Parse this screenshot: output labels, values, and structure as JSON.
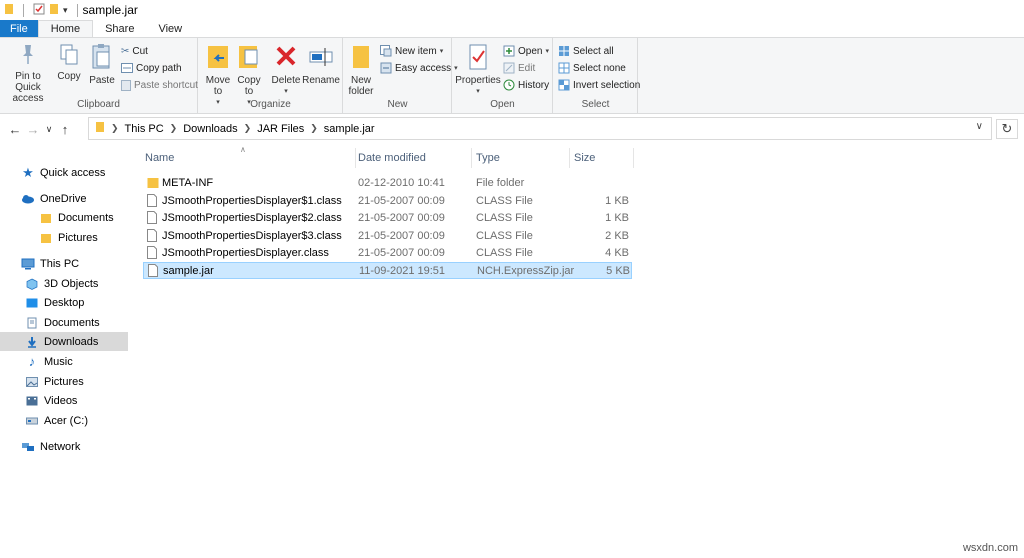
{
  "window": {
    "title": "sample.jar"
  },
  "tabs": [
    {
      "label": "File"
    },
    {
      "label": "Home"
    },
    {
      "label": "Share"
    },
    {
      "label": "View"
    }
  ],
  "ribbon": {
    "clipboard": {
      "label": "Clipboard",
      "pin": "Pin to Quick access",
      "copy": "Copy",
      "paste": "Paste",
      "cut": "Cut",
      "copy_path": "Copy path",
      "paste_shortcut": "Paste shortcut"
    },
    "organize": {
      "label": "Organize",
      "move_to": "Move to",
      "copy_to": "Copy to",
      "delete": "Delete",
      "rename": "Rename"
    },
    "new": {
      "label": "New",
      "new_folder": "New folder",
      "new_item": "New item",
      "easy_access": "Easy access"
    },
    "open": {
      "label": "Open",
      "properties": "Properties",
      "open": "Open",
      "edit": "Edit",
      "history": "History"
    },
    "select": {
      "label": "Select",
      "select_all": "Select all",
      "select_none": "Select none",
      "invert": "Invert selection"
    }
  },
  "address": {
    "crumbs": [
      "This PC",
      "Downloads",
      "JAR Files",
      "sample.jar"
    ]
  },
  "nav": {
    "quick_access": "Quick access",
    "onedrive": "OneDrive",
    "documents1": "Documents",
    "pictures1": "Pictures",
    "this_pc": "This PC",
    "objects3d": "3D Objects",
    "desktop": "Desktop",
    "documents2": "Documents",
    "downloads": "Downloads",
    "music": "Music",
    "pictures2": "Pictures",
    "videos": "Videos",
    "acer": "Acer (C:)",
    "network": "Network"
  },
  "columns": {
    "name": "Name",
    "date": "Date modified",
    "type": "Type",
    "size": "Size"
  },
  "files": [
    {
      "name": "META-INF",
      "date": "02-12-2010 10:41",
      "type": "File folder",
      "size": ""
    },
    {
      "name": "JSmoothPropertiesDisplayer$1.class",
      "date": "21-05-2007 00:09",
      "type": "CLASS File",
      "size": "1 KB"
    },
    {
      "name": "JSmoothPropertiesDisplayer$2.class",
      "date": "21-05-2007 00:09",
      "type": "CLASS File",
      "size": "1 KB"
    },
    {
      "name": "JSmoothPropertiesDisplayer$3.class",
      "date": "21-05-2007 00:09",
      "type": "CLASS File",
      "size": "2 KB"
    },
    {
      "name": "JSmoothPropertiesDisplayer.class",
      "date": "21-05-2007 00:09",
      "type": "CLASS File",
      "size": "4 KB"
    },
    {
      "name": "sample.jar",
      "date": "11-09-2021 19:51",
      "type": "NCH.ExpressZip.jar",
      "size": "5 KB"
    }
  ],
  "watermark": "wsxdn.com"
}
